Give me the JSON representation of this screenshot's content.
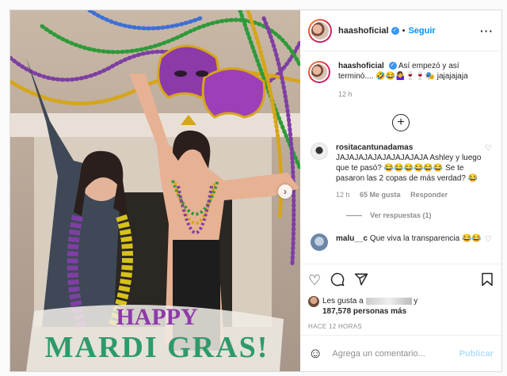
{
  "post": {
    "username": "haashoficial",
    "follow_label": "Seguir",
    "more_label": "···",
    "caption_text": "Así empezó y así terminó.... 🤣😂🤷‍♀️🍷🍷🎭 jajajajaja",
    "caption_time": "12 h",
    "load_more_icon": "plus-circle-icon"
  },
  "comments": [
    {
      "username": "rositacantunadamas",
      "text": "JAJAJAJAJAJAJAJAJAJA Ashley y luego que te pasó? 😂😂😂😂😂😂 Se te pasaron las 2 copas de más verdad? 😂",
      "time": "12 h",
      "likes": "65 Me gusta",
      "reply_label": "Responder",
      "view_replies": "Ver respuestas (1)"
    },
    {
      "username": "malu__c",
      "text": "Que viva la transparencia 😂😂"
    }
  ],
  "actions": {
    "likes_prefix": "Les gusta a",
    "likes_suffix": "y",
    "likes_count": "187,578 personas más",
    "ago": "HACE 12 HORAS"
  },
  "composer": {
    "placeholder": "Agrega un comentario...",
    "publish_label": "Publicar"
  },
  "image": {
    "banner_line1": "HAPPY",
    "banner_line2": "MARDI GRAS!"
  },
  "colors": {
    "accent": "#0095f6",
    "muted": "#8e8e8e"
  }
}
